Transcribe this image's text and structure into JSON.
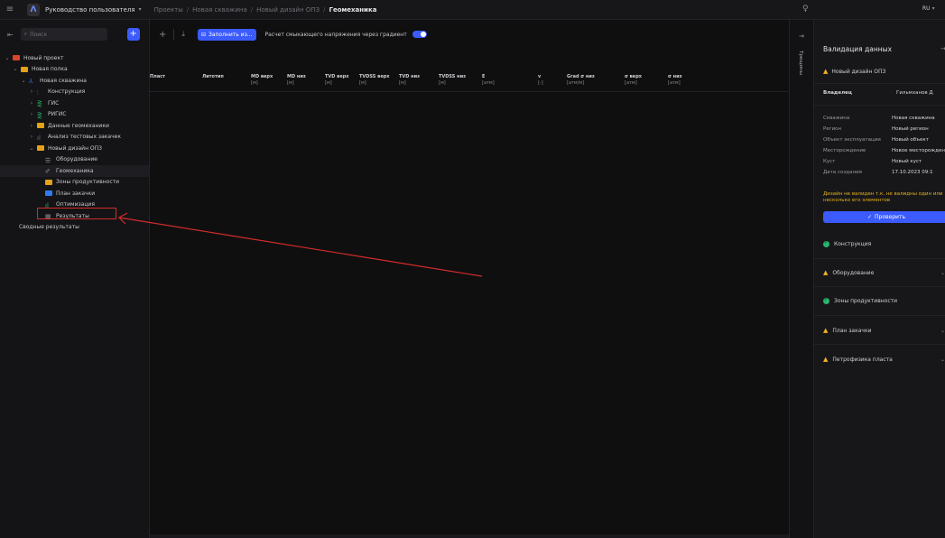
{
  "topbar": {
    "app_title": "Руководство пользователя",
    "breadcrumbs": [
      "Проекты",
      "Новая скважина",
      "Новый дизайн ОПЗ"
    ],
    "current": "Геомеханика",
    "language": "RU"
  },
  "left": {
    "search_placeholder": "Поиск",
    "tree": [
      {
        "label": "Новый проект",
        "level": 0,
        "arrow": "⌄",
        "icon": "folder-red"
      },
      {
        "label": "Новая полка",
        "level": 1,
        "arrow": "⌄",
        "icon": "folder-yellow"
      },
      {
        "label": "Новая скважина",
        "level": 2,
        "arrow": "⌄",
        "icon": "well"
      },
      {
        "label": "Конструкция",
        "level": 3,
        "arrow": "›",
        "icon": "construction"
      },
      {
        "label": "ГИС",
        "level": 3,
        "arrow": "›",
        "icon": "gis"
      },
      {
        "label": "РИГИС",
        "level": 3,
        "arrow": "›",
        "icon": "rigis"
      },
      {
        "label": "Данные геомеханики",
        "level": 3,
        "arrow": "›",
        "icon": "folder-yellow"
      },
      {
        "label": "Анализ тестовых закачек",
        "level": 3,
        "arrow": "›",
        "icon": "bars"
      },
      {
        "label": "Новый дизайн ОПЗ",
        "level": 3,
        "arrow": "⌄",
        "icon": "design"
      },
      {
        "label": "Оборудование",
        "level": 4,
        "arrow": "",
        "icon": "equipment"
      },
      {
        "label": "Геомеханика",
        "level": 4,
        "arrow": "",
        "icon": "geomech",
        "selected": true
      },
      {
        "label": "Зоны продуктивности",
        "level": 4,
        "arrow": "",
        "icon": "zones"
      },
      {
        "label": "План закачки",
        "level": 4,
        "arrow": "",
        "icon": "plan"
      },
      {
        "label": "Оптимизация",
        "level": 4,
        "arrow": "",
        "icon": "optimization"
      },
      {
        "label": "Результаты",
        "level": 4,
        "arrow": "",
        "icon": "results"
      },
      {
        "label": "Сводные результаты",
        "level": 1,
        "arrow": "",
        "icon": ""
      }
    ]
  },
  "toolbar": {
    "fill_button": "Заполнить из...",
    "gradient_label": "Расчет смыкающего напряжения через градиент",
    "gradient_on": true
  },
  "table": {
    "columns": [
      {
        "name": "Пласт",
        "unit": ""
      },
      {
        "name": "Литотип",
        "unit": ""
      },
      {
        "name": "MD верх",
        "unit": "[м]"
      },
      {
        "name": "MD низ",
        "unit": "[м]"
      },
      {
        "name": "TVD верх",
        "unit": "[м]"
      },
      {
        "name": "TVDSS верх",
        "unit": "[м]"
      },
      {
        "name": "TVD низ",
        "unit": "[м]"
      },
      {
        "name": "TVDSS низ",
        "unit": "[м]"
      },
      {
        "name": "E",
        "unit": "[атм]"
      },
      {
        "name": "v",
        "unit": "[-]"
      },
      {
        "name": "Grad σ низ",
        "unit": "[атм/м]"
      },
      {
        "name": "σ верх",
        "unit": "[атм]"
      },
      {
        "name": "σ низ",
        "unit": "[атм]"
      }
    ],
    "rows": []
  },
  "vtab": {
    "label": "Трещины"
  },
  "right": {
    "title": "Валидация данных",
    "design_name": "Новый дизайн ОПЗ",
    "owner_label": "Владелец",
    "owner_value": "Гильмханов Д",
    "props": [
      {
        "label": "Скважина",
        "value": "Новая скважина"
      },
      {
        "label": "Регион",
        "value": "Новый регион"
      },
      {
        "label": "Объект эксплуатации",
        "value": "Новый объект"
      },
      {
        "label": "Месторождение",
        "value": "Новое месторождение"
      },
      {
        "label": "Куст",
        "value": "Новый куст"
      },
      {
        "label": "Дата создания",
        "value": "17.10.2023 09:1"
      }
    ],
    "warning_text": "Дизайн не валиден т.к. не валидны один или несколько его элементов",
    "check_button": "Проверить",
    "sections": [
      {
        "label": "Конструкция",
        "status": "ok"
      },
      {
        "label": "Оборудование",
        "status": "warn"
      },
      {
        "label": "Зоны продуктивности",
        "status": "ok"
      },
      {
        "label": "План закачки",
        "status": "warn"
      },
      {
        "label": "Петрофизика пласта",
        "status": "warn"
      }
    ]
  },
  "annotation": {
    "color": "#d42b2b"
  }
}
